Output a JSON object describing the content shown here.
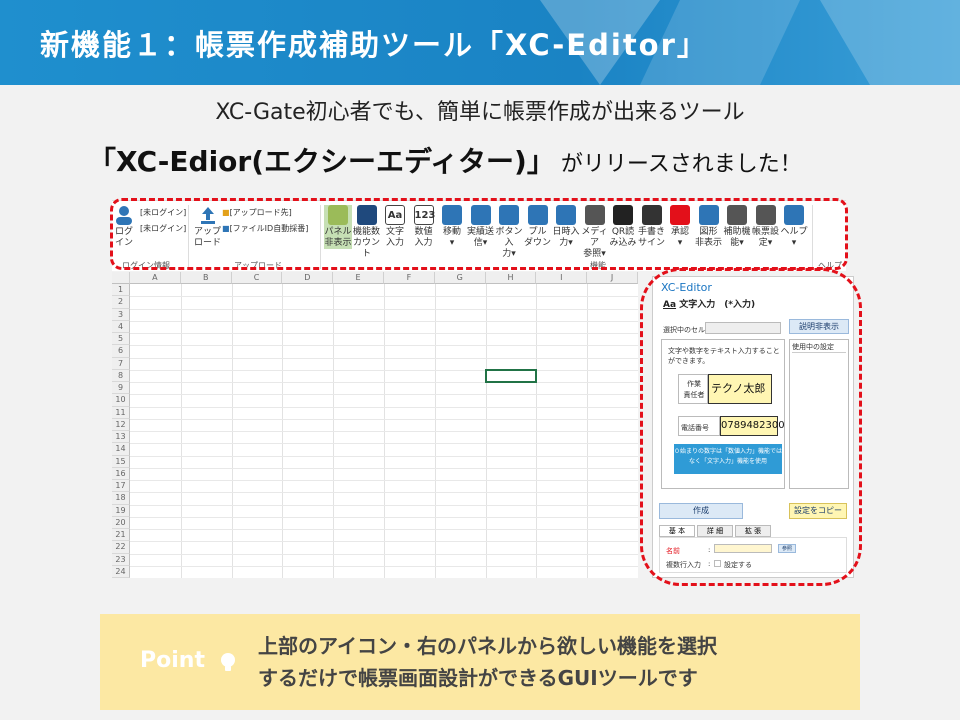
{
  "header": {
    "title": "新機能１：帳票作成補助ツール「XC-Editor」"
  },
  "intro": {
    "line1": "XC-Gate初心者でも、簡単に帳票作成が出来るツール",
    "line2_bold": "「XC-Edior(エクシーエディター)」",
    "line2_tail": "がリリースされました！"
  },
  "ribbon": {
    "login": {
      "label1": "ログ",
      "label2": "イン",
      "status1": "[未ログイン]",
      "status2": "[未ログイン]",
      "group": "ログイン情報"
    },
    "upload": {
      "label1": "アップ",
      "label2": "ロード",
      "dest": "[アップロード先]",
      "fileid": "[ファイルID自動採番]",
      "group": "アップロード"
    },
    "items": [
      {
        "l1": "パネル",
        "l2": "非表示",
        "color": "#9bbb59"
      },
      {
        "l1": "機能数",
        "l2": "カウント",
        "color": "#1f497d"
      },
      {
        "l1": "文字",
        "l2": "入力",
        "color": "#ffffff",
        "glyph": "Aa"
      },
      {
        "l1": "数値",
        "l2": "入力",
        "color": "#ffffff",
        "glyph": "123"
      },
      {
        "l1": "移動",
        "l2": "▾",
        "color": "#2e75b6"
      },
      {
        "l1": "実績送",
        "l2": "信▾",
        "color": "#2e75b6"
      },
      {
        "l1": "ボタン入",
        "l2": "力▾",
        "color": "#2e75b6"
      },
      {
        "l1": "プル",
        "l2": "ダウン",
        "color": "#2e75b6"
      },
      {
        "l1": "日時入",
        "l2": "力▾",
        "color": "#2e75b6"
      },
      {
        "l1": "メディア",
        "l2": "参照▾",
        "color": "#555555"
      },
      {
        "l1": "QR読",
        "l2": "み込み",
        "color": "#222222"
      },
      {
        "l1": "手書き",
        "l2": "サイン",
        "color": "#333333"
      },
      {
        "l1": "承認",
        "l2": "▾",
        "color": "#e3101a"
      },
      {
        "l1": "図形",
        "l2": "非表示",
        "color": "#2e75b6"
      },
      {
        "l1": "補助機",
        "l2": "能▾",
        "color": "#555555"
      },
      {
        "l1": "帳票設",
        "l2": "定▾",
        "color": "#555555"
      },
      {
        "l1": "ヘルプ",
        "l2": "▾",
        "color": "#2e75b6"
      }
    ],
    "group_kino": "機能",
    "group_help": "ヘルプ"
  },
  "sheet": {
    "columns": [
      "A",
      "B",
      "C",
      "D",
      "E",
      "F",
      "G",
      "H",
      "I",
      "J"
    ],
    "rows": [
      "1",
      "2",
      "3",
      "4",
      "5",
      "6",
      "7",
      "8",
      "9",
      "10",
      "11",
      "12",
      "13",
      "14",
      "15",
      "16",
      "17",
      "18",
      "19",
      "20",
      "21",
      "22",
      "23",
      "24"
    ]
  },
  "editor": {
    "title": "XC-Editor",
    "subtitle": "文字入力　(*入力)",
    "selected_label": "選択中のセル：",
    "hide_desc_button": "説明非表示",
    "settings_in_use": "使用中の設定",
    "desc": "文字や数字をテキスト入力することができます。",
    "field1_label": "作業\n責任者",
    "field1_value": "テクノ太郎",
    "field2_label": "電話番号",
    "field2_value": "0789482300",
    "tip": "０始まりの数字は「数値入力」機能ではなく「文字入力」機能を使用",
    "create_button": "作成",
    "copy_button": "設定をコピー",
    "tabs": [
      "基 本",
      "詳 細",
      "拡 張"
    ],
    "name_label": "名前",
    "colon": ":",
    "ref_button": "参照",
    "required_label": "複数行入力",
    "required_check": "設定する"
  },
  "point": {
    "label": "Point",
    "line1": "上部のアイコン・右のパネルから欲しい機能を選択",
    "line2": "するだけで帳票画面設計ができるGUIツールです"
  },
  "colors": {
    "banner": "#1f8fce",
    "accent_red": "#e3101a",
    "point_bg": "#fce8a3",
    "editor_title": "#1a75c2"
  }
}
